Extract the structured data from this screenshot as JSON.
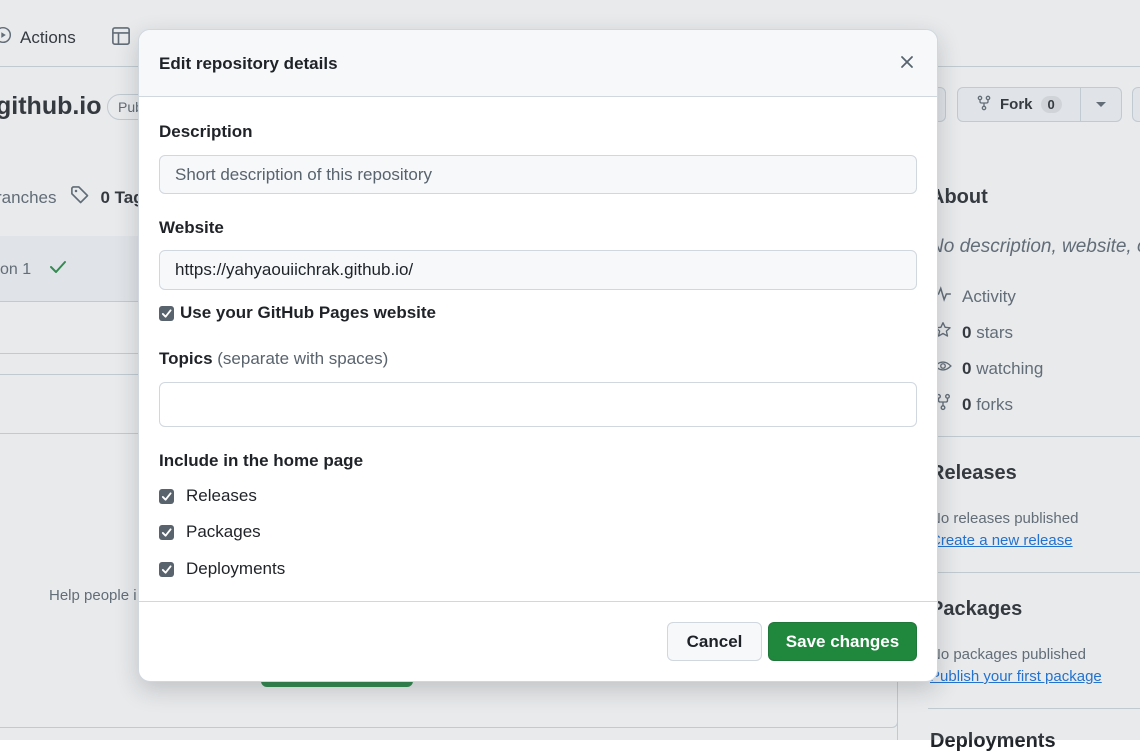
{
  "background": {
    "nav": {
      "actions_label": "Actions"
    },
    "repo": {
      "name_fragment": "github.io",
      "visibility_fragment": "Pub"
    },
    "fork": {
      "label": "Fork",
      "count": "0"
    },
    "branches": {
      "branches_fragment": "ranches",
      "tags_fragment": "0 Tag"
    },
    "commit_fragment": "on 1",
    "help_fragment": "Help people i",
    "sidebar": {
      "about_heading": "About",
      "about_description": "No description, website, o",
      "activity_label": "Activity",
      "stars_count": "0",
      "stars_label": "stars",
      "watching_count": "0",
      "watching_label": "watching",
      "forks_count": "0",
      "forks_label": "forks",
      "releases_heading": "Releases",
      "releases_empty": "No releases published",
      "releases_link": "Create a new release",
      "packages_heading": "Packages",
      "packages_empty": "No packages published",
      "packages_link": "Publish your first package",
      "deployments_fragment": "Deployments"
    }
  },
  "modal": {
    "title": "Edit repository details",
    "description": {
      "label": "Description",
      "value": "",
      "placeholder": "Short description of this repository"
    },
    "website": {
      "label": "Website",
      "value": "https://yahyaouiichrak.github.io/",
      "use_pages_label": "Use your GitHub Pages website",
      "use_pages_checked": true
    },
    "topics": {
      "label": "Topics",
      "hint": "(separate with spaces)",
      "value": ""
    },
    "home_page": {
      "heading": "Include in the home page",
      "options": [
        {
          "label": "Releases",
          "checked": true
        },
        {
          "label": "Packages",
          "checked": true
        },
        {
          "label": "Deployments",
          "checked": true
        }
      ]
    },
    "buttons": {
      "cancel": "Cancel",
      "save": "Save changes"
    }
  },
  "colors": {
    "primary_button": "#1f883d",
    "link": "#0969da",
    "border": "#d0d7de",
    "muted_text": "#59636e"
  }
}
